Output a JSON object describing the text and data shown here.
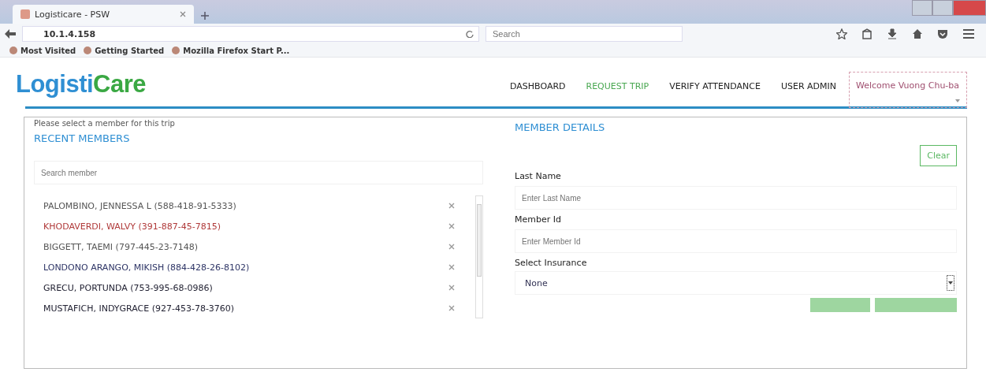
{
  "browser": {
    "tab_title": "Logisticare - PSW",
    "address": "10.1.4.158",
    "search_placeholder": "Search",
    "bookmarks": [
      "Most Visited",
      "Getting Started",
      "Mozilla Firefox Start P..."
    ]
  },
  "header": {
    "logo": {
      "part_1": "Logisti",
      "part_2": "Care"
    },
    "nav": [
      {
        "label": "DASHBOARD",
        "selected": false
      },
      {
        "label": "REQUEST TRIP",
        "selected": true
      },
      {
        "label": "VERIFY ATTENDANCE",
        "selected": false
      },
      {
        "label": "USER ADMIN",
        "selected": false
      }
    ],
    "welcome": "Welcome Vuong Chu-ba"
  },
  "instruction": "Please select a member for this trip",
  "recent_members": {
    "title": "RECENT MEMBERS",
    "search_placeholder": "Search member",
    "items": [
      {
        "name": "PALOMBINO, JENNESSA L (588-418-91-5333)",
        "color": "#555555"
      },
      {
        "name": "KHODAVERDI, WALVY (391-887-45-7815)",
        "color": "#b03a3a"
      },
      {
        "name": "BIGGETT, TAEMI (797-445-23-7148)",
        "color": "#555555"
      },
      {
        "name": "LONDONO ARANGO, MIKISH (884-428-26-8102)",
        "color": "#2e3566"
      },
      {
        "name": "GRECU, PORTUNDA (753-995-68-0986)",
        "color": "#222233"
      },
      {
        "name": "MUSTAFICH, INDYGRACE (927-453-78-3760)",
        "color": "#222233"
      }
    ]
  },
  "member_details": {
    "title": "MEMBER DETAILS",
    "clear_button": "Clear",
    "fields": [
      {
        "kind": "text",
        "label": "Last Name",
        "placeholder": "Enter Last Name"
      },
      {
        "kind": "text",
        "label": "Member Id",
        "placeholder": "Enter Member Id"
      },
      {
        "kind": "select",
        "label": "Select Insurance",
        "value": "None"
      }
    ],
    "action_buttons": [
      {
        "kind": "primary"
      },
      {
        "kind": "primary"
      }
    ]
  }
}
